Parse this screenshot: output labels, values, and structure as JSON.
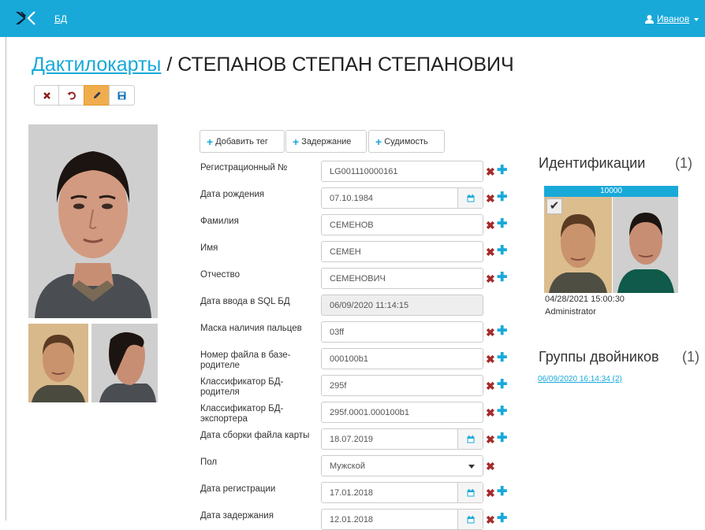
{
  "topbar": {
    "nav_label": "БД",
    "user_name": "Иванов"
  },
  "page": {
    "breadcrumb": "Дактилокарты",
    "separator": "/",
    "name": "СТЕПАНОВ СТЕПАН СТЕПАНОВИЧ"
  },
  "toolbar": {
    "icons": [
      "close-icon",
      "undo-icon",
      "pencil-icon",
      "save-icon"
    ],
    "active": "pencil-icon"
  },
  "tags": [
    "Добавить тег",
    "Задержание",
    "Судимость"
  ],
  "fields": [
    {
      "label": "Регистрационный №",
      "value": "LG001110000161",
      "type": "text",
      "actions": [
        "remove",
        "add"
      ]
    },
    {
      "label": "Дата рождения",
      "value": "07.10.1984",
      "type": "date",
      "actions": [
        "remove",
        "add"
      ]
    },
    {
      "label": "Фамилия",
      "value": "СЕМЕНОВ",
      "type": "text",
      "actions": [
        "remove",
        "add"
      ]
    },
    {
      "label": "Имя",
      "value": "СЕМЕН",
      "type": "text",
      "actions": [
        "remove",
        "add"
      ]
    },
    {
      "label": "Отчество",
      "value": "СЕМЕНОВИЧ",
      "type": "text",
      "actions": [
        "remove",
        "add"
      ]
    },
    {
      "label": "Дата ввода в SQL БД",
      "value": "06/09/2020 11:14:15",
      "type": "readonly",
      "actions": []
    },
    {
      "label": "Маска наличия пальцев",
      "value": "03ff",
      "type": "text",
      "actions": [
        "remove",
        "add"
      ]
    },
    {
      "label": "Номер файла в базе-родителе",
      "value": "000100b1",
      "type": "text",
      "actions": [
        "remove",
        "add"
      ]
    },
    {
      "label": "Классификатор БД-родителя",
      "value": "295f",
      "type": "text",
      "actions": [
        "remove",
        "add"
      ]
    },
    {
      "label": "Классификатор БД-экспортера",
      "value": "295f.0001.000100b1",
      "type": "text",
      "actions": [
        "remove",
        "add"
      ]
    },
    {
      "label": "Дата сборки файла карты",
      "value": "18.07.2019",
      "type": "date",
      "actions": [
        "remove",
        "add"
      ]
    },
    {
      "label": "Пол",
      "value": "Мужской",
      "type": "select",
      "actions": [
        "remove"
      ]
    },
    {
      "label": "Дата регистрации",
      "value": "17.01.2018",
      "type": "date",
      "actions": [
        "remove",
        "add"
      ]
    },
    {
      "label": "Дата задержания",
      "value": "12.01.2018",
      "type": "date",
      "actions": [
        "remove",
        "add"
      ]
    }
  ],
  "identifications": {
    "title": "Идентификации",
    "count": "(1)",
    "card": {
      "score": "10000",
      "date": "04/28/2021 15:00:30",
      "user": "Administrator"
    }
  },
  "twins": {
    "title": "Группы двойников",
    "count": "(1)",
    "link": "06/09/2020 16:14:34 (2)"
  },
  "colors": {
    "accent": "#18a9d9",
    "danger": "#a52a2a",
    "active": "#f0ad4e"
  }
}
